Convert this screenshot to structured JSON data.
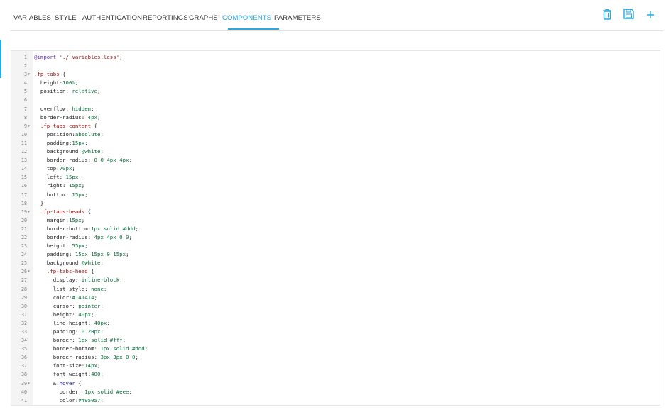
{
  "tabs": [
    {
      "label": "VARIABLES"
    },
    {
      "label": "STYLE"
    },
    {
      "label": "AUTHENTICATION"
    },
    {
      "label": "REPORTINGS"
    },
    {
      "label": "GRAPHS"
    },
    {
      "label": "COMPONENTS"
    },
    {
      "label": "PARAMETERS"
    }
  ],
  "active_tab": "COMPONENTS",
  "actions": [
    {
      "icon": "trash-icon",
      "color": "#2aa9df"
    },
    {
      "icon": "save-icon",
      "color": "#2aa9df"
    },
    {
      "icon": "plus-icon",
      "color": "#2aa9df"
    }
  ],
  "editor": {
    "lines": [
      {
        "n": "1",
        "fold": "",
        "text": "@import './_variables.less';"
      },
      {
        "n": "2",
        "fold": "",
        "text": ""
      },
      {
        "n": "3",
        "fold": "▼",
        "text": ".fp-tabs {"
      },
      {
        "n": "4",
        "fold": "",
        "text": "  height:100%;"
      },
      {
        "n": "5",
        "fold": "",
        "text": "  position: relative;"
      },
      {
        "n": "6",
        "fold": "",
        "text": ""
      },
      {
        "n": "7",
        "fold": "",
        "text": "  overflow: hidden;"
      },
      {
        "n": "8",
        "fold": "",
        "text": "  border-radius: 4px;"
      },
      {
        "n": "9",
        "fold": "▼",
        "text": "  .fp-tabs-content {"
      },
      {
        "n": "10",
        "fold": "",
        "text": "    position:absolute;"
      },
      {
        "n": "11",
        "fold": "",
        "text": "    padding:15px;"
      },
      {
        "n": "12",
        "fold": "",
        "text": "    background:@white;"
      },
      {
        "n": "13",
        "fold": "",
        "text": "    border-radius: 0 0 4px 4px;"
      },
      {
        "n": "14",
        "fold": "",
        "text": "    top:70px;"
      },
      {
        "n": "15",
        "fold": "",
        "text": "    left: 15px;"
      },
      {
        "n": "16",
        "fold": "",
        "text": "    right: 15px;"
      },
      {
        "n": "17",
        "fold": "",
        "text": "    bottom: 15px;"
      },
      {
        "n": "18",
        "fold": "",
        "text": "  }"
      },
      {
        "n": "19",
        "fold": "▼",
        "text": "  .fp-tabs-heads {"
      },
      {
        "n": "20",
        "fold": "",
        "text": "    margin:15px;"
      },
      {
        "n": "21",
        "fold": "",
        "text": "    border-bottom:1px solid #ddd;"
      },
      {
        "n": "22",
        "fold": "",
        "text": "    border-radius: 4px 4px 0 0;"
      },
      {
        "n": "23",
        "fold": "",
        "text": "    height: 55px;"
      },
      {
        "n": "24",
        "fold": "",
        "text": "    padding: 15px 15px 0 15px;"
      },
      {
        "n": "25",
        "fold": "",
        "text": "    background:@white;"
      },
      {
        "n": "26",
        "fold": "▼",
        "text": "    .fp-tabs-head {"
      },
      {
        "n": "27",
        "fold": "",
        "text": "      display: inline-block;"
      },
      {
        "n": "28",
        "fold": "",
        "text": "      list-style: none;"
      },
      {
        "n": "29",
        "fold": "",
        "text": "      color:#141414;"
      },
      {
        "n": "30",
        "fold": "",
        "text": "      cursor: pointer;"
      },
      {
        "n": "31",
        "fold": "",
        "text": "      height: 40px;"
      },
      {
        "n": "32",
        "fold": "",
        "text": "      line-height: 40px;"
      },
      {
        "n": "33",
        "fold": "",
        "text": "      padding: 0 20px;"
      },
      {
        "n": "34",
        "fold": "",
        "text": "      border: 1px solid #fff;"
      },
      {
        "n": "35",
        "fold": "",
        "text": "      border-bottom: 1px solid #ddd;"
      },
      {
        "n": "36",
        "fold": "",
        "text": "      border-radius: 3px 3px 0 0;"
      },
      {
        "n": "37",
        "fold": "",
        "text": "      font-size:14px;"
      },
      {
        "n": "38",
        "fold": "",
        "text": "      font-weight:400;"
      },
      {
        "n": "39",
        "fold": "▼",
        "text": "      &:hover {"
      },
      {
        "n": "40",
        "fold": "",
        "text": "        border: 1px solid #eee;"
      },
      {
        "n": "41",
        "fold": "",
        "text": "        color:#495057;"
      }
    ]
  }
}
